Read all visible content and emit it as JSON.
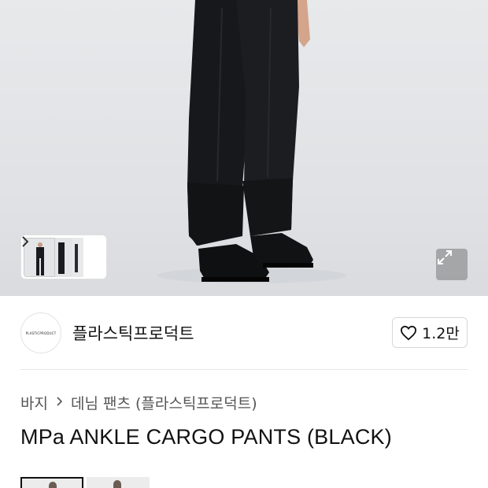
{
  "hero": {
    "image_alt": "black cargo pants product photo",
    "thumbnail_count": 3,
    "expand_icon": "expand-icon",
    "next_icon": "chevron-right-icon"
  },
  "brand": {
    "logo_text": "PLASTICPRODUCT",
    "name": "플라스틱프로덕트",
    "like_icon": "heart-outline-icon",
    "like_count": "1.2만"
  },
  "breadcrumb": {
    "items": [
      "바지",
      "데님 팬츠 (플라스틱프로덕트)"
    ],
    "separator_icon": "chevron-right-icon"
  },
  "product": {
    "title": "MPa ANKLE CARGO PANTS (BLACK)"
  },
  "colors": {
    "background": "#ffffff",
    "hero_bg": "#e2e4e7",
    "text": "#111111",
    "muted": "#555555",
    "border": "#d7d7d7"
  }
}
